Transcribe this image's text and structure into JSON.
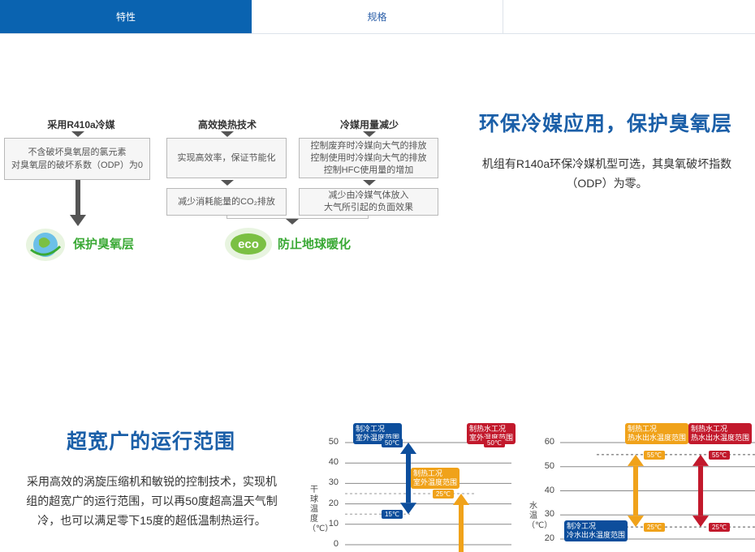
{
  "tabs": [
    {
      "label": "特性"
    },
    {
      "label": "规格"
    },
    {
      "label": ""
    }
  ],
  "eco_section": {
    "title": "环保冷媒应用，保护臭氧层",
    "description_line1": "机组有R140a环保冷媒机型可选，其臭氧破坏指数",
    "description_line2": "（ODP）为零。",
    "diagram": {
      "col1": {
        "header": "采用R410a冷媒",
        "box_line1": "不含破坏臭氧层的氯元素",
        "box_line2": "对臭氧层的破坏系数（ODP）为0",
        "result": "保护臭氧层"
      },
      "col2": {
        "header": "高效换热技术",
        "box1": "实现高效率，保证节能化",
        "box2": "减少消耗能量的CO₂排放",
        "result": "防止地球暖化",
        "eco_logo": "eco"
      },
      "col3": {
        "header": "冷媒用量减少",
        "box1_line1": "控制废弃时冷媒向大气的排放",
        "box1_line2": "控制使用时冷媒向大气的排放",
        "box1_line3": "控制HFC使用量的增加",
        "box2_line1": "减少由冷媒气体放入",
        "box2_line2": "大气所引起的负面效果"
      }
    }
  },
  "range_section": {
    "title": "超宽广的运行范围",
    "line1": "采用高效的涡旋压缩机和敏锐的控制技术，实现机",
    "line2": "组的超宽广的运行范围，可以再50度超高温天气制",
    "line3": "冷，也可以满足零下15度的超低温制热运行。"
  },
  "chart_data": [
    {
      "type": "range",
      "ylabel": "干球温度（℃）",
      "yticks": [
        0,
        10,
        20,
        30,
        40,
        50
      ],
      "series": [
        {
          "name_line1": "制冷工况",
          "name_line2": "室外温度范围",
          "low_label": "15℃",
          "high_label": "50℃",
          "low": 15,
          "high": 50,
          "color": "#0d4e9c"
        },
        {
          "name_line1": "制热工况",
          "name_line2": "室外温度范围",
          "high_label": "25℃",
          "low": 0,
          "high": 25,
          "color": "#f0a21a"
        },
        {
          "name_line1": "制热水工况",
          "name_line2": "室外温度范围",
          "high_label": "50℃",
          "low": 0,
          "high": 50,
          "color": "#c2192c"
        }
      ]
    },
    {
      "type": "range",
      "ylabel": "水温（℃）",
      "yticks": [
        20,
        30,
        40,
        50,
        60
      ],
      "series": [
        {
          "name_line1": "制热工况",
          "name_line2": "热水出水温度范围",
          "low_label": "25℃",
          "high_label": "55℃",
          "low": 25,
          "high": 55,
          "color": "#f0a21a"
        },
        {
          "name_line1": "制热水工况",
          "name_line2": "热水出水温度范围",
          "low_label": "25℃",
          "high_label": "55℃",
          "low": 25,
          "high": 55,
          "color": "#c2192c"
        },
        {
          "name_line1": "制冷工况",
          "name_line2": "冷水出水温度范围",
          "color": "#0d4e9c"
        }
      ]
    }
  ]
}
